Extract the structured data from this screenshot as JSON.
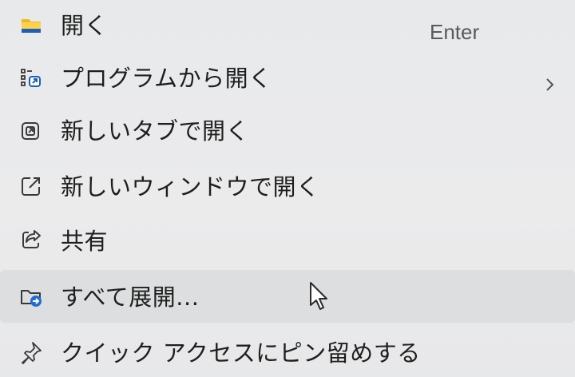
{
  "menu": {
    "items": [
      {
        "label": "開く",
        "shortcut": "Enter",
        "icon": "folder-icon"
      },
      {
        "label": "プログラムから開く",
        "icon": "open-with-icon",
        "submenu_indicator": "chevron-right-icon"
      },
      {
        "label": "新しいタブで開く",
        "icon": "new-tab-icon"
      },
      {
        "label": "新しいウィンドウで開く",
        "icon": "new-window-icon"
      },
      {
        "label": "共有",
        "icon": "share-icon"
      },
      {
        "label": "すべて展開...",
        "icon": "extract-all-icon"
      },
      {
        "label": "クイック アクセスにピン留めする",
        "icon": "pin-icon"
      }
    ]
  },
  "colors": {
    "background": "#e9eaec",
    "hover_background": "#dddedf",
    "text": "#1e1e1e",
    "shortcut_text": "#5a5a5a",
    "folder_yellow": "#f2b824",
    "folder_blue": "#1f5fb8",
    "icon_stroke": "#3a3a3a",
    "icon_accent": "#1f6fd1"
  },
  "hovered_item_index": 5
}
